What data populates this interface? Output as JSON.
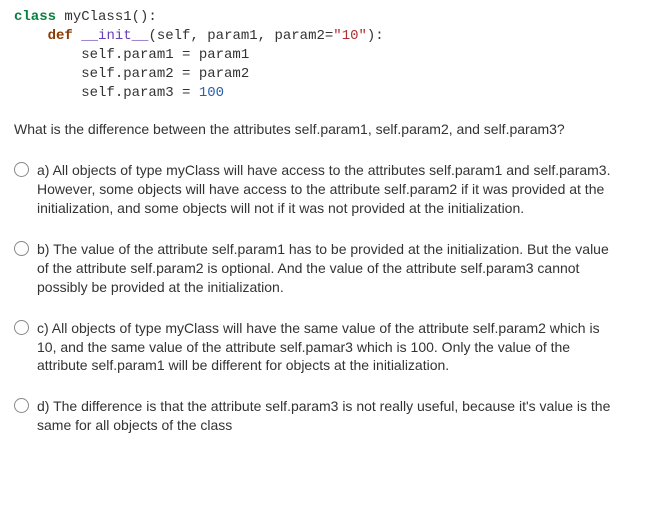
{
  "code": {
    "line1_kw": "class",
    "line1_rest": " myClass1():",
    "line2_kw": "def",
    "line2_init": "__init__",
    "line2_rest_a": "(self, param1, param2=",
    "line2_str": "\"10\"",
    "line2_rest_b": "):",
    "line3": "        self.param1 = param1",
    "line4": "        self.param2 = param2",
    "line5_a": "        self.param3 = ",
    "line5_num": "100"
  },
  "question": "What is the difference between the attributes self.param1, self.param2, and self.param3?",
  "options": {
    "a": "a) All objects of type myClass will have access to the attributes self.param1 and self.param3. However, some objects will have access to the attribute self.param2 if it was provided at the initialization, and some objects will not if it was not provided at the initialization.",
    "b": "b) The value of the attribute self.param1 has to be provided at the initialization. But the value of the attribute self.param2 is optional. And the value of the attribute self.param3 cannot possibly be provided at the initialization.",
    "c": "c) All objects of type myClass will have the same value of the attribute self.param2 which is 10, and the same value of the attribute self.pamar3 which is 100. Only the value of the attribute self.param1 will be different for objects at the initialization.",
    "d": "d) The difference is that the attribute self.param3 is not really useful, because it's value is the same for all objects of the class"
  }
}
